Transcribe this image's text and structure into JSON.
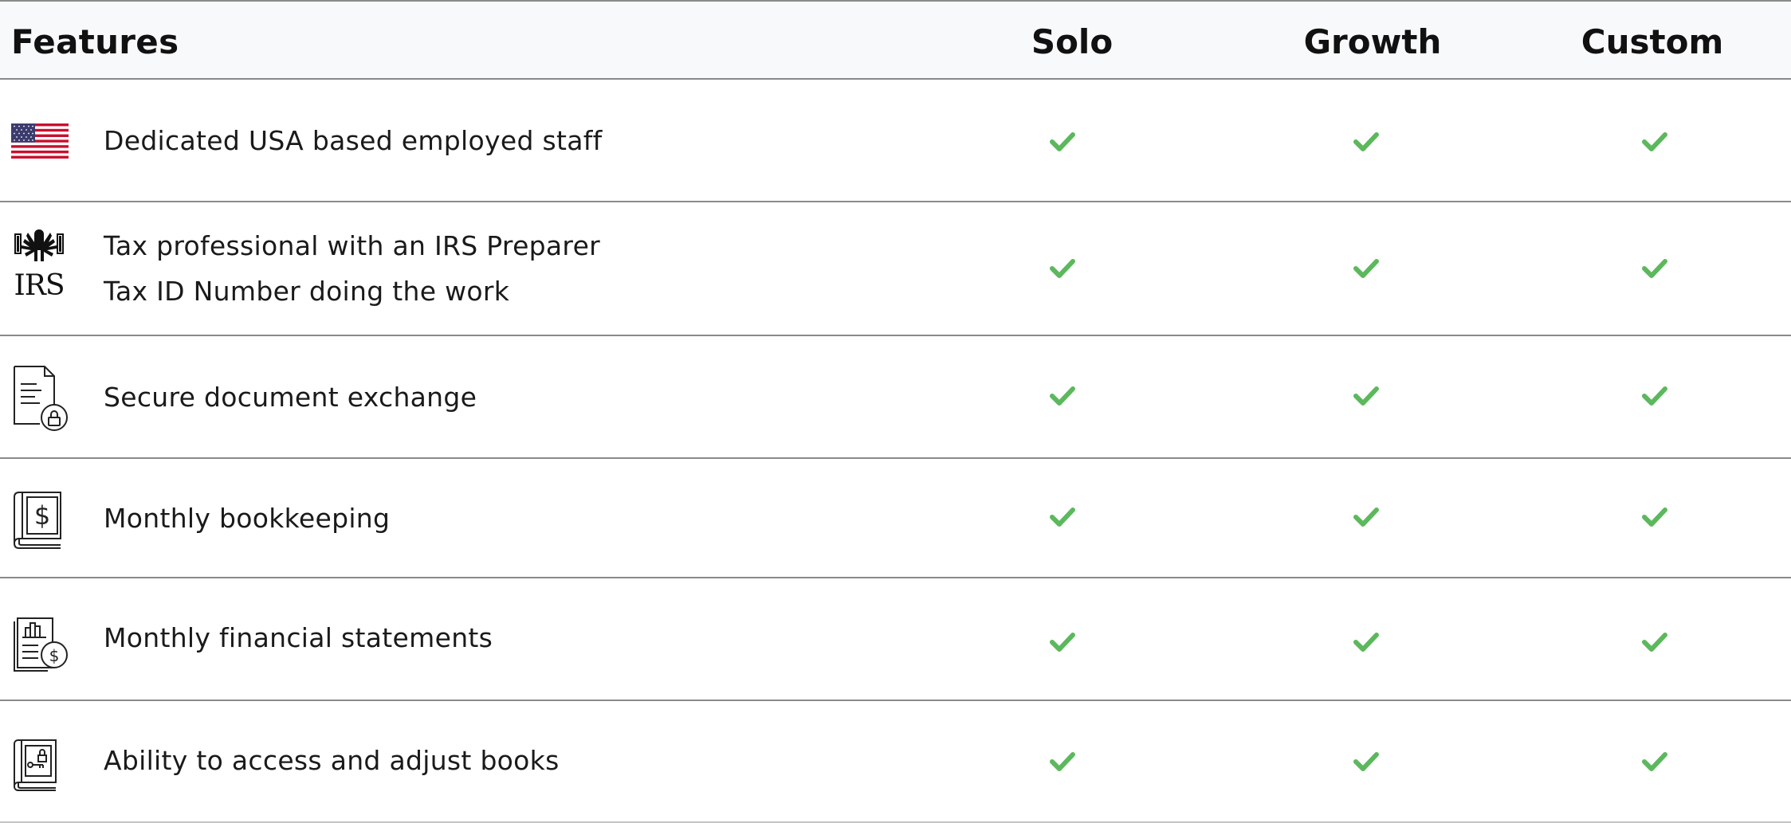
{
  "header": {
    "features_label": "Features",
    "plans": [
      "Solo",
      "Growth",
      "Custom"
    ]
  },
  "rows": [
    {
      "icon": "usa-flag-icon",
      "lines": [
        "Dedicated USA based employed staff"
      ],
      "solo": true,
      "growth": true,
      "custom": true
    },
    {
      "icon": "irs-logo-icon",
      "lines": [
        "Tax professional with an IRS Preparer",
        "Tax ID Number doing the work"
      ],
      "solo": true,
      "growth": true,
      "custom": true
    },
    {
      "icon": "secure-document-icon",
      "lines": [
        "Secure document exchange"
      ],
      "solo": true,
      "growth": true,
      "custom": true
    },
    {
      "icon": "bookkeeping-book-icon",
      "lines": [
        "Monthly bookkeeping"
      ],
      "solo": true,
      "growth": true,
      "custom": true
    },
    {
      "icon": "financial-statements-icon",
      "lines": [
        "Monthly financial statements"
      ],
      "solo": true,
      "growth": true,
      "custom": true
    },
    {
      "icon": "access-books-icon",
      "lines": [
        "Ability to access and adjust books"
      ],
      "solo": true,
      "growth": true,
      "custom": true
    }
  ],
  "irs_logo_text": "IRS",
  "colors": {
    "check": "#5cb85c",
    "divider": "#8a8a8a",
    "header_bg": "#f8f9fb"
  }
}
